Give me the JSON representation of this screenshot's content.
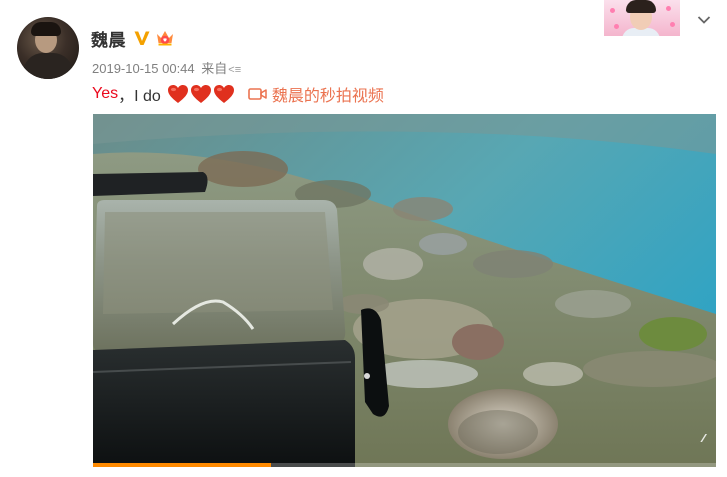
{
  "user": {
    "name": "魏晨",
    "verified_icon": "verified-v-icon",
    "vip_icon": "vip-crown-icon",
    "avatar_icon": "user-avatar"
  },
  "meta": {
    "timestamp": "2019-10-15 00:44",
    "source_prefix": "来自",
    "source_fragment": "<≡"
  },
  "post": {
    "text_yes": "Yes",
    "text_rest": "，I do",
    "hearts_count": 3,
    "heart_color": "#e0301e",
    "video_link_text": "魏晨的秒拍视频",
    "video_link_color": "#eb7350",
    "video_icon": "video-camera-icon"
  },
  "video": {
    "progress_fraction": 0.285,
    "progress_color": "#ff8a00",
    "corner_mark": "⁄⁄"
  },
  "header_right": {
    "chevron_icon": "chevron-down-icon",
    "mini_avatar": "mini-avatar-image"
  }
}
